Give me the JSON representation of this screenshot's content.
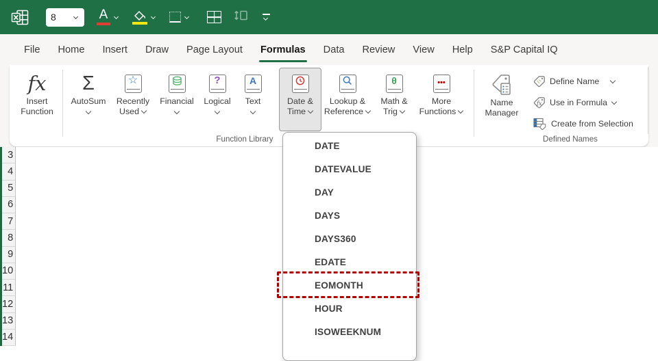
{
  "titlebar": {
    "font_size_value": "8",
    "font_color_letter": "A"
  },
  "menu": {
    "tabs": [
      {
        "label": "File"
      },
      {
        "label": "Home"
      },
      {
        "label": "Insert"
      },
      {
        "label": "Draw"
      },
      {
        "label": "Page Layout"
      },
      {
        "label": "Formulas",
        "active": true
      },
      {
        "label": "Data"
      },
      {
        "label": "Review"
      },
      {
        "label": "View"
      },
      {
        "label": "Help"
      },
      {
        "label": "S&P Capital IQ"
      }
    ]
  },
  "ribbon": {
    "function_library_label": "Function Library",
    "defined_names_label": "Defined Names",
    "buttons": {
      "insert_function": {
        "icon_text": "fx",
        "l1": "Insert",
        "l2": "Function"
      },
      "autosum": {
        "icon_text": "Σ",
        "l1": "AutoSum"
      },
      "recently_used": {
        "glyph": "☆",
        "l1": "Recently",
        "l2": "Used"
      },
      "financial": {
        "l1": "Financial"
      },
      "logical": {
        "glyph": "?",
        "l1": "Logical"
      },
      "text": {
        "glyph": "A",
        "l1": "Text"
      },
      "date_time": {
        "l1": "Date &",
        "l2": "Time",
        "pressed": true
      },
      "lookup_reference": {
        "l1": "Lookup &",
        "l2": "Reference"
      },
      "math_trig": {
        "glyph": "θ",
        "l1": "Math &",
        "l2": "Trig"
      },
      "more_functions": {
        "glyph": "•••",
        "l1": "More",
        "l2": "Functions"
      },
      "name_manager": {
        "l1": "Name",
        "l2": "Manager"
      },
      "define_name": {
        "label": "Define Name"
      },
      "use_in_formula": {
        "label": "Use in Formula"
      },
      "create_from_selection": {
        "label": "Create from Selection"
      }
    }
  },
  "dropdown": {
    "items": [
      "DATE",
      "DATEVALUE",
      "DAY",
      "DAYS",
      "DAYS360",
      "EDATE",
      "EOMONTH",
      "HOUR",
      "ISOWEEKNUM"
    ],
    "highlighted_item": "EOMONTH"
  },
  "sheet": {
    "rows": [
      "3",
      "4",
      "5",
      "6",
      "7",
      "8",
      "9",
      "10",
      "11",
      "12",
      "13",
      "14"
    ]
  },
  "colors": {
    "excel_green": "#1f7145",
    "active_tab_underline": "#1f7145",
    "highlight_red": "#b00000",
    "pressed_button_bg": "#e5e5e5"
  }
}
